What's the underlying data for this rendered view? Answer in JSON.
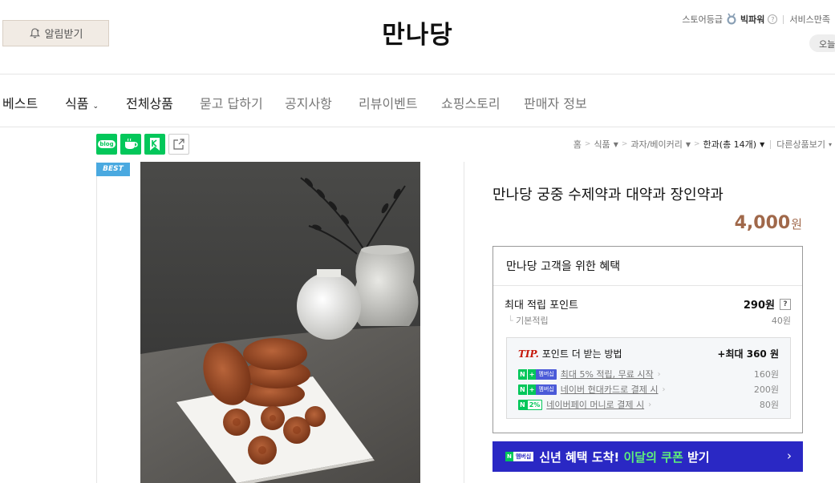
{
  "header": {
    "alarm_label": "알림받기",
    "store_title": "만나당",
    "store_grade_label": "스토어등급",
    "store_grade_value": "빅파워",
    "service_label": "서비스만족",
    "today_label": "오늘"
  },
  "nav": {
    "items": [
      {
        "label": "베스트"
      },
      {
        "label": "식품"
      },
      {
        "label": "전체상품"
      },
      {
        "label": "묻고 답하기"
      },
      {
        "label": "공지사항"
      },
      {
        "label": "리뷰이벤트"
      },
      {
        "label": "쇼핑스토리"
      },
      {
        "label": "판매자 정보"
      }
    ]
  },
  "share": {
    "blog_label": "blog"
  },
  "breadcrumb": {
    "home": "홈",
    "level1": "식품",
    "level2": "과자/베이커리",
    "level3": "한과(총 14개)",
    "other": "다른상품보기"
  },
  "product": {
    "badge": "BEST",
    "name": "만나당 궁중 수제약과 대약과 장인약과",
    "price": "4,000",
    "price_unit": "원"
  },
  "benefit": {
    "title": "만나당 고객을 위한 혜택",
    "max_point_label": "최대 적립 포인트",
    "max_point_value": "290원",
    "basic_label": "기본적립",
    "basic_value": "40원",
    "tip_word": "TIP.",
    "tip_text": "포인트 더 받는 방법",
    "tip_max": "+최대 360 원",
    "rows": [
      {
        "text": "최대 5% 적립, 무료 시작",
        "value": "160원"
      },
      {
        "text": "네이버 현대카드로 결제 시",
        "value": "200원"
      },
      {
        "text": "네이버페이 머니로 결제 시",
        "value": "80원"
      }
    ],
    "badge_n": "N",
    "badge_plus": "+",
    "badge_membership": "멤버십",
    "badge_pct": "2%"
  },
  "coupon": {
    "part1": "신년 혜택 도착! ",
    "highlight1": "이달의",
    "space": " ",
    "highlight2": "쿠폰",
    "part2": " 받기",
    "chevron": "›"
  },
  "colors": {
    "naver_green": "#03c75a",
    "price_brown": "#a0684a",
    "coupon_blue": "#2a28c4",
    "best_blue": "#4aa9e0"
  }
}
